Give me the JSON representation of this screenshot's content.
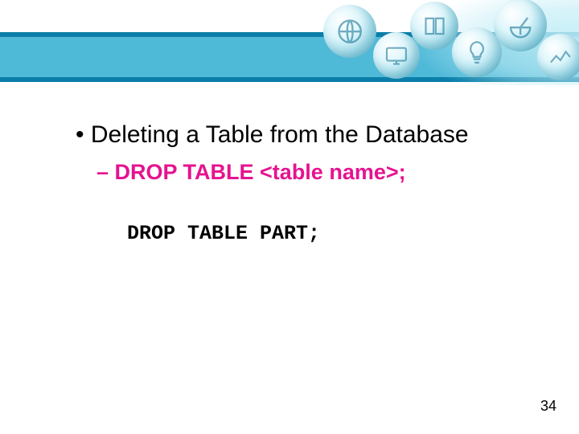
{
  "slide": {
    "bullet_main": "Deleting a Table from the Database",
    "bullet_sub": "DROP TABLE <table name>;",
    "code_line": "DROP TABLE PART;",
    "page_number": "34"
  },
  "header_icons": [
    "globe-icon",
    "screen-icon",
    "book-icon",
    "bulb-icon",
    "dish-icon",
    "chart-icon"
  ],
  "colors": {
    "accent_pink": "#e51390",
    "header_teal": "#4fb9d8",
    "band_border": "#0a7ea8"
  }
}
